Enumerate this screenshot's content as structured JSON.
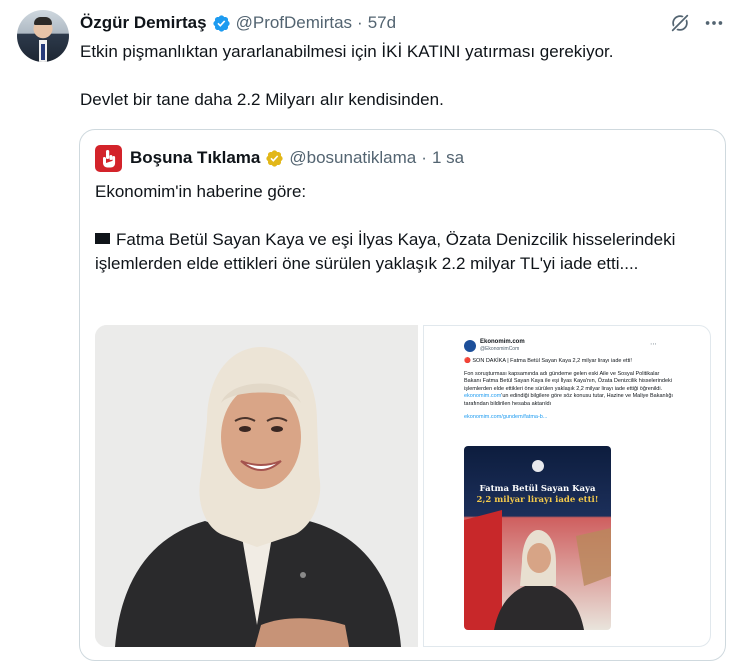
{
  "tweet": {
    "author_name": "Özgür Demirtaş",
    "handle": "@ProfDemirtas",
    "separator": "·",
    "time": "57d",
    "paragraphs": [
      "Etkin pişmanlıktan yararlanabilmesi için İKİ KATINI yatırması gerekiyor.",
      "Devlet bir tane daha 2.2 Milyarı alır kendisinden."
    ]
  },
  "quote": {
    "author_name": "Boşuna Tıklama",
    "handle": "@bosunatiklama",
    "separator": "·",
    "time": "1 sa",
    "paragraph_1": "Ekonomim'in haberine göre:",
    "paragraph_2": "Fatma Betül Sayan Kaya ve eşi İlyas Kaya, Özata Denizcilik hisselerindeki işlemlerden elde ettikleri öne sürülen yaklaşık 2.2 milyar TL'yi iade etti...."
  },
  "screenshot": {
    "author_name": "Ekonomim.com",
    "handle": "@EkonomimCom",
    "headline": "🔴 SON DAKİKA | Fatma Betül Sayan Kaya 2,2 milyar lirayı iade etti!",
    "body_start": "Fon soruşturması kapsamında adı gündeme gelen eski Aile ve Sosyal Politikalar Bakanı Fatma Betül Sayan Kaya ile eşi İlyas Kaya'nın, Özata Denizcilik hisselerindeki işlemlerden elde ettikleri öne sürülen yaklaşık 2,2 milyar lirayı iade ettiği öğrenildi. ",
    "body_link": "ekonomim.com",
    "body_end": "'un edindiği bilgilere göre söz konusu tutar, Hazine ve Maliye Bakanlığı tarafından bildirilen hesaba aktarıldı",
    "url": "ekonomim.com/gundem/fatma-b...",
    "card_line_1": "Fatma Betül Sayan Kaya",
    "card_line_2": "2,2 milyar lirayı iade etti!"
  },
  "icons": {
    "verified": "verified-badge-icon",
    "grok": "grok-icon",
    "more": "more-icon",
    "quote_avatar": "bosuna-tiklama-logo"
  },
  "colors": {
    "text": "#0f1419",
    "secondary": "#536471",
    "verified_blue": "#1d9bf0",
    "verified_gold": "#e2b719",
    "border": "#cfd9de",
    "logo_red": "#d3232a"
  }
}
